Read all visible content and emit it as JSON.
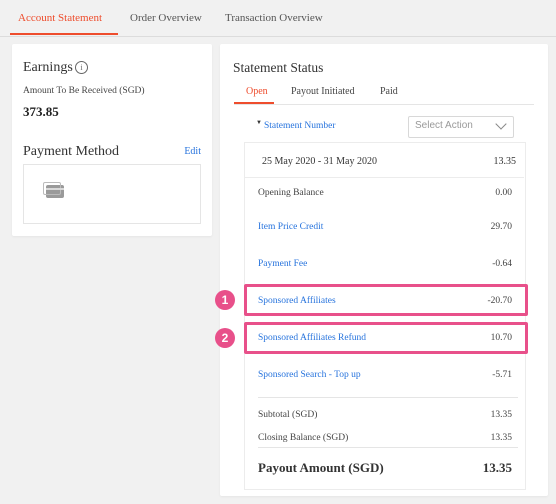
{
  "tabs": [
    {
      "label": "Account Statement",
      "active": true
    },
    {
      "label": "Order Overview",
      "active": false
    },
    {
      "label": "Transaction Overview",
      "active": false
    }
  ],
  "earnings": {
    "title": "Earnings",
    "info_icon": "info-icon",
    "amount_label": "Amount To Be Received (SGD)",
    "amount_value": "373.85"
  },
  "payment_method": {
    "title": "Payment Method",
    "edit_label": "Edit",
    "card_icon": "credit-card-icon"
  },
  "statement": {
    "title": "Statement Status",
    "sub_tabs": [
      {
        "label": "Open",
        "active": true
      },
      {
        "label": "Payout Initiated",
        "active": false
      },
      {
        "label": "Paid",
        "active": false
      }
    ],
    "number_label": "Statement Number",
    "select_placeholder": "Select Action",
    "period_label": "25 May 2020 - 31 May 2020",
    "period_value": "13.35",
    "rows": [
      {
        "label": "Opening Balance",
        "value": "0.00",
        "link": false
      },
      {
        "label": "Item Price Credit",
        "value": "29.70",
        "link": true
      },
      {
        "label": "Payment Fee",
        "value": "-0.64",
        "link": true
      },
      {
        "label": "Sponsored Affiliates",
        "value": "-20.70",
        "link": true,
        "highlight": "1"
      },
      {
        "label": "Sponsored Affiliates Refund",
        "value": "10.70",
        "link": true,
        "highlight": "2"
      },
      {
        "label": "Sponsored Search - Top up",
        "value": "-5.71",
        "link": true
      }
    ],
    "subtotal_label": "Subtotal (SGD)",
    "subtotal_value": "13.35",
    "closing_label": "Closing Balance (SGD)",
    "closing_value": "13.35",
    "payout_label": "Payout Amount (SGD)",
    "payout_value": "13.35"
  },
  "colors": {
    "accent": "#ee4d2d",
    "link": "#2673dd",
    "highlight": "#e8508a"
  }
}
